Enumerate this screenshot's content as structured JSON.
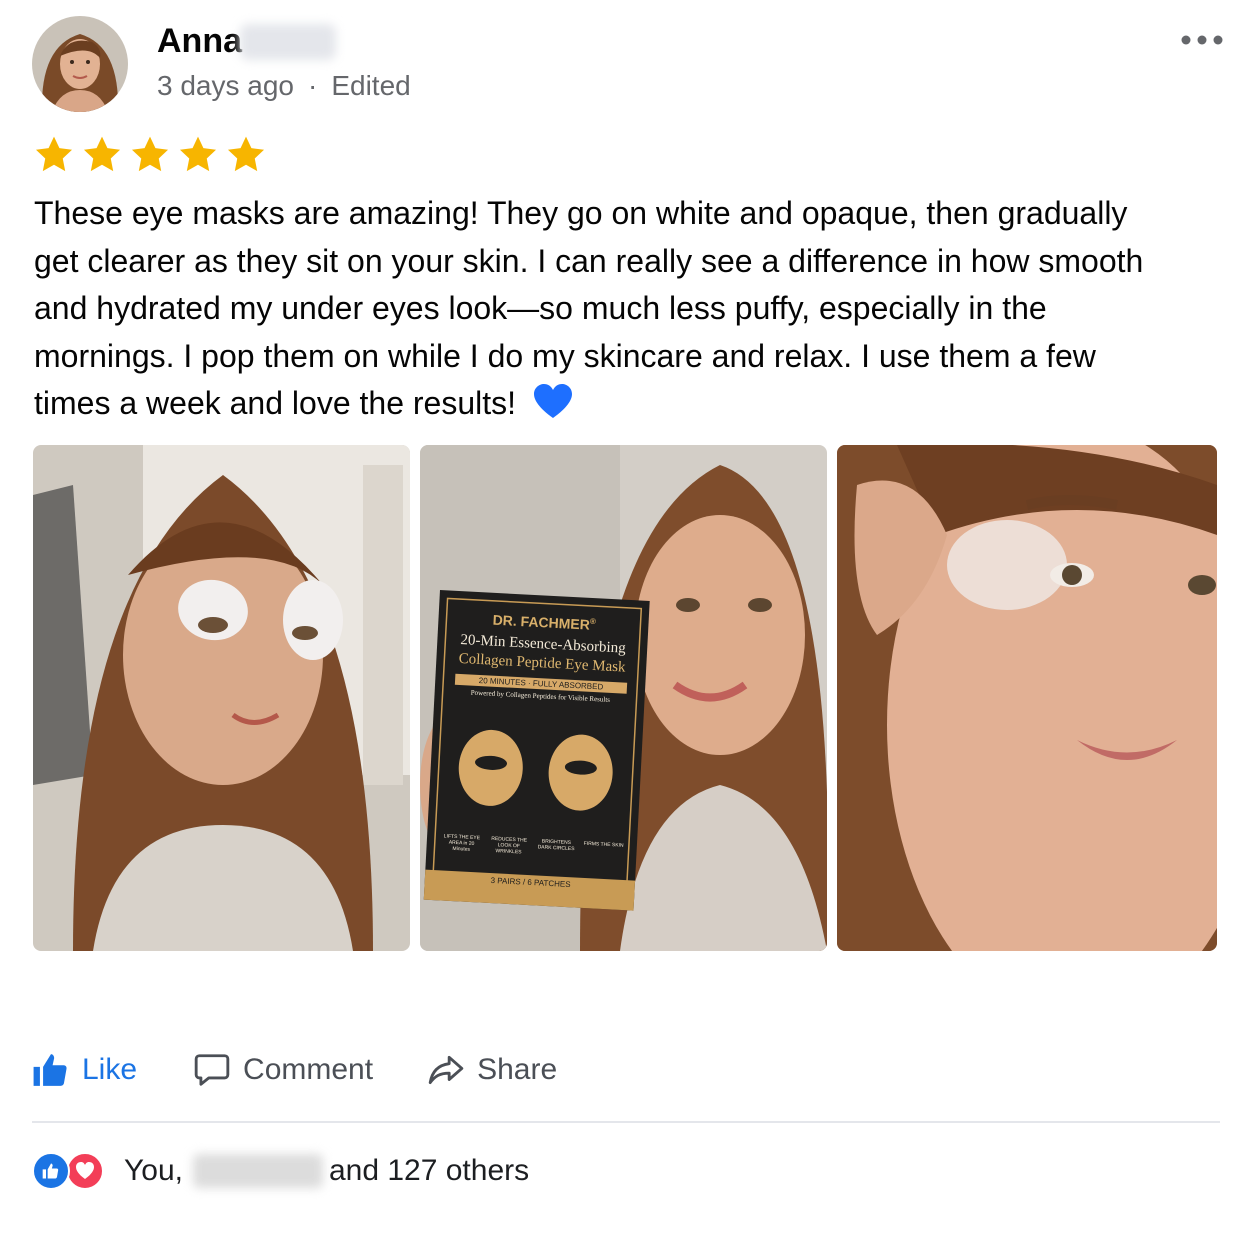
{
  "post": {
    "author_first": "Anna",
    "time": "3 days ago",
    "separator": "·",
    "edited": "Edited",
    "rating": 5,
    "text": "These eye masks are amazing! They go on white and opaque, then gradually get clearer as they sit on your skin. I can really see a difference in how smooth and hydrated my under eyes look—so much less puffy, especially in the mornings. I pop them on while I do my skincare and relax. I use them a few times a week and love the results!",
    "emoji": "💙"
  },
  "product_box": {
    "brand": "DR. FACHMER",
    "registered": "®",
    "title_line1": "20-Min Essence-Absorbing",
    "title_line2": "Collagen Peptide Eye Mask",
    "banner": "20 MINUTES · FULLY ABSORBED",
    "subtitle": "Powered by Collagen Peptides for Visible Results",
    "benefits": [
      "LIFTS THE EYE AREA in 20 Minutes",
      "REDUCES THE LOOK OF WRINKLES",
      "BRIGHTENS DARK CIRCLES",
      "FIRMS THE SKIN"
    ],
    "count": "3 PAIRS / 6 PATCHES"
  },
  "actions": {
    "like": "Like",
    "comment": "Comment",
    "share": "Share"
  },
  "reactions": {
    "prefix": "You,",
    "suffix": "and 127 others"
  },
  "colors": {
    "star": "#f7b500",
    "like_blue": "#1b74e4",
    "love_red": "#f33e58",
    "heart_blue": "#1e6fff"
  }
}
